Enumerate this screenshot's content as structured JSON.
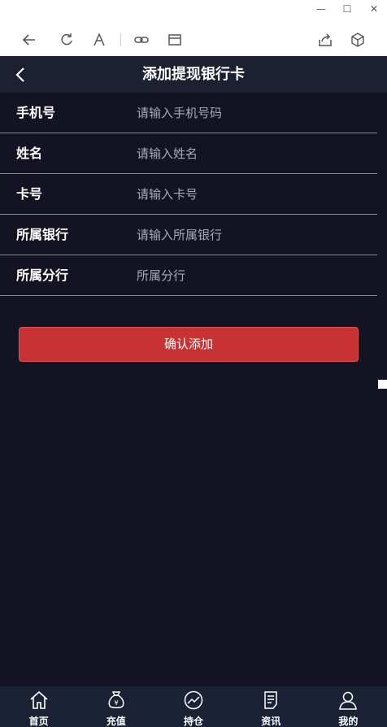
{
  "window": {
    "controls": [
      "—",
      "☐",
      "✕"
    ]
  },
  "header": {
    "title": "添加提现银行卡"
  },
  "form": {
    "fields": [
      {
        "label": "手机号",
        "placeholder": "请输入手机号码",
        "value": ""
      },
      {
        "label": "姓名",
        "placeholder": "请输入姓名",
        "value": ""
      },
      {
        "label": "卡号",
        "placeholder": "请输入卡号",
        "value": ""
      },
      {
        "label": "所属银行",
        "placeholder": "请输入所属银行",
        "value": ""
      },
      {
        "label": "所属分行",
        "placeholder": "所属分行",
        "value": ""
      }
    ],
    "confirm_label": "确认添加"
  },
  "bottom_nav": {
    "items": [
      {
        "label": "首页",
        "icon": "home-icon"
      },
      {
        "label": "充值",
        "icon": "money-bag-icon"
      },
      {
        "label": "持仓",
        "icon": "chart-trend-icon"
      },
      {
        "label": "资讯",
        "icon": "news-icon"
      },
      {
        "label": "我的",
        "icon": "user-icon"
      }
    ]
  },
  "colors": {
    "background": "#131324",
    "header": "#1c2030",
    "accent_button": "#c83232",
    "nav_background": "#1c2236"
  }
}
